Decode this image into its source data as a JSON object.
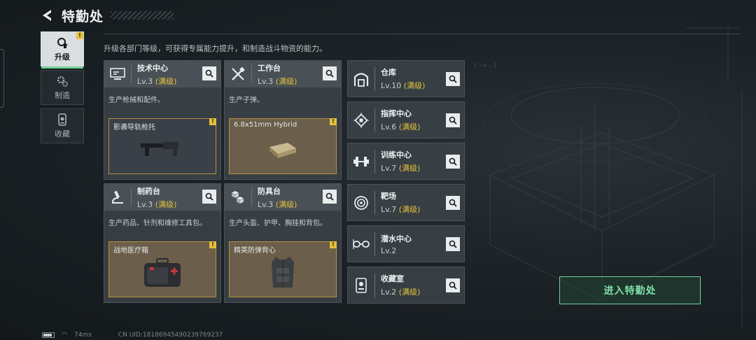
{
  "header": {
    "title": "特勤处"
  },
  "side_tabs": [
    {
      "label": "升级",
      "active": true,
      "alert": "!"
    },
    {
      "label": "制造",
      "active": false
    },
    {
      "label": "收藏",
      "active": false
    }
  ],
  "description": "升级各部门等级，可获得专属能力提升，和制造战斗物资的能力。",
  "cards": [
    {
      "name": "技术中心",
      "level": "Lv.3",
      "max": "(满级)",
      "desc": "生产枪械和配件。",
      "item": "影袭导轨枪托",
      "alert": "!"
    },
    {
      "name": "工作台",
      "level": "Lv.3",
      "max": "(满级)",
      "desc": "生产子弹。",
      "item": "6.8x51mm Hybrid",
      "alert": "!"
    },
    {
      "name": "制药台",
      "level": "Lv.3",
      "max": "(满级)",
      "desc": "生产药品、针剂和维修工具包。",
      "item": "战地医疗箱",
      "alert": "!"
    },
    {
      "name": "防具台",
      "level": "Lv.3",
      "max": "(满级)",
      "desc": "生产头盔、护甲、胸挂和背包。",
      "item": "精英防弹背心",
      "alert": "!"
    }
  ],
  "facilities": [
    {
      "name": "仓库",
      "level": "Lv.10",
      "max": "(满级)",
      "icon": "warehouse-icon"
    },
    {
      "name": "指挥中心",
      "level": "Lv.6",
      "max": "(满级)",
      "icon": "chip-icon"
    },
    {
      "name": "训练中心",
      "level": "Lv.7",
      "max": "(满级)",
      "icon": "dumbbell-icon"
    },
    {
      "name": "靶场",
      "level": "Lv.7",
      "max": "(满级)",
      "icon": "target-icon"
    },
    {
      "name": "潜水中心",
      "level": "Lv.2",
      "max": "",
      "icon": "goggles-icon"
    },
    {
      "name": "收藏室",
      "level": "Lv.2",
      "max": "(满级)",
      "icon": "trophy-icon"
    }
  ],
  "enter_button": "进入特勤处",
  "status": {
    "ping": "74ms",
    "uid": "CN UID:18186945490239769237"
  },
  "colors": {
    "accent": "#6fd39a",
    "max_level": "#e3c13d",
    "alert": "#e3c13d"
  }
}
